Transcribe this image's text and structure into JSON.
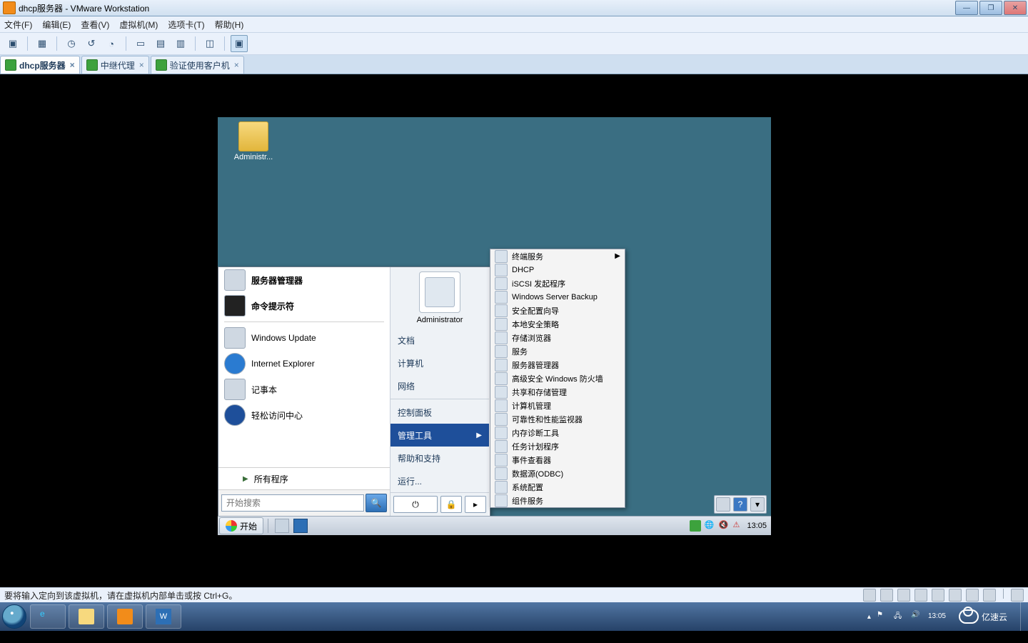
{
  "host": {
    "title": "dhcp服务器 - VMware Workstation",
    "menu": [
      "文件(F)",
      "编辑(E)",
      "查看(V)",
      "虚拟机(M)",
      "选项卡(T)",
      "帮助(H)"
    ],
    "tabs": [
      {
        "label": "dhcp服务器",
        "active": true
      },
      {
        "label": "中继代理",
        "active": false
      },
      {
        "label": "验证使用客户机",
        "active": false
      }
    ],
    "status_hint": "要将输入定向到该虚拟机，请在虚拟机内部单击或按 Ctrl+G。"
  },
  "guest": {
    "desktop_icon_label": "Administr...",
    "taskbar": {
      "start": "开始",
      "clock": "13:05"
    },
    "start_menu": {
      "left_pinned": [
        {
          "label": "服务器管理器",
          "bold": true
        },
        {
          "label": "命令提示符",
          "bold": true
        },
        {
          "label": "Windows Update",
          "bold": false
        },
        {
          "label": "Internet Explorer",
          "bold": false
        },
        {
          "label": "记事本",
          "bold": false
        },
        {
          "label": "轻松访问中心",
          "bold": false
        }
      ],
      "all_programs": "所有程序",
      "search_placeholder": "开始搜索",
      "profile_name": "Administrator",
      "right_items": [
        {
          "label": "文档"
        },
        {
          "label": "计算机"
        },
        {
          "label": "网络"
        },
        {
          "label": "控制面板"
        },
        {
          "label": "管理工具",
          "submenu": true,
          "highlight": true
        },
        {
          "label": "帮助和支持"
        },
        {
          "label": "运行..."
        }
      ]
    },
    "admin_tools_submenu": [
      {
        "label": "终端服务",
        "has_sub": true
      },
      {
        "label": "DHCP"
      },
      {
        "label": "iSCSI 发起程序"
      },
      {
        "label": "Windows Server Backup"
      },
      {
        "label": "安全配置向导"
      },
      {
        "label": "本地安全策略"
      },
      {
        "label": "存储浏览器"
      },
      {
        "label": "服务"
      },
      {
        "label": "服务器管理器"
      },
      {
        "label": "高级安全 Windows 防火墙"
      },
      {
        "label": "共享和存储管理"
      },
      {
        "label": "计算机管理"
      },
      {
        "label": "可靠性和性能监视器"
      },
      {
        "label": "内存诊断工具"
      },
      {
        "label": "任务计划程序"
      },
      {
        "label": "事件查看器"
      },
      {
        "label": "数据源(ODBC)"
      },
      {
        "label": "系统配置"
      },
      {
        "label": "组件服务"
      }
    ]
  },
  "win7_tray": {
    "time": "13:05",
    "date": "",
    "brand": "亿速云"
  }
}
